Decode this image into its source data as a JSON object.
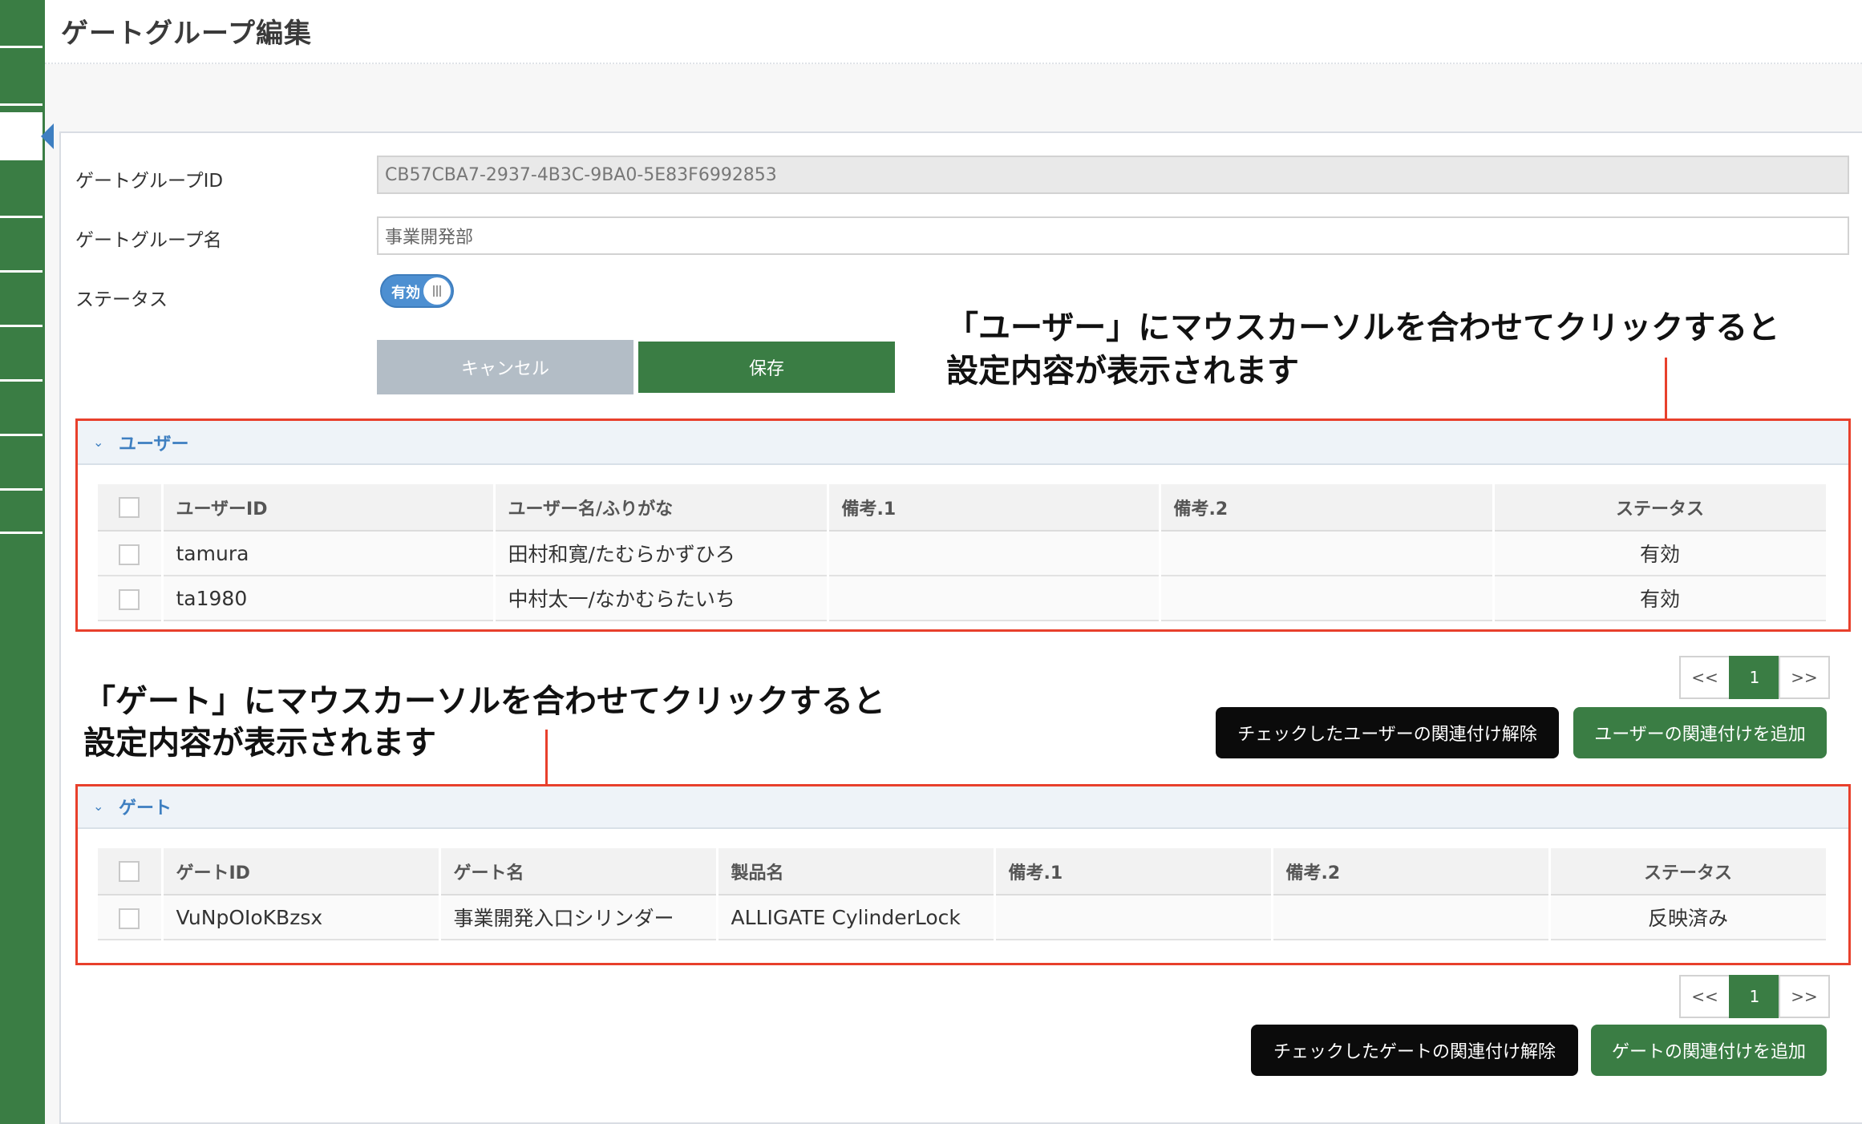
{
  "page": {
    "title": "ゲートグループ編集"
  },
  "form": {
    "gate_group_id_label": "ゲートグループID",
    "gate_group_id_value": "CB57CBA7-2937-4B3C-9BA0-5E83F6992853",
    "gate_group_name_label": "ゲートグループ名",
    "gate_group_name_value": "事業開発部",
    "status_label": "ステータス",
    "status_toggle_label": "有効",
    "cancel_label": "キャンセル",
    "save_label": "保存"
  },
  "annotations": {
    "user_line1": "「ユーザー」にマウスカーソルを合わせてクリックすると",
    "user_line2": "設定内容が表示されます",
    "gate_line1": "「ゲート」にマウスカーソルを合わせてクリックすると",
    "gate_line2": "設定内容が表示されます"
  },
  "users": {
    "section_title": "ユーザー",
    "columns": {
      "id": "ユーザーID",
      "name": "ユーザー名/ふりがな",
      "note1": "備考.1",
      "note2": "備考.2",
      "status": "ステータス"
    },
    "rows": [
      {
        "id": "tamura",
        "name": "田村和寛/たむらかずひろ",
        "note1": "",
        "note2": "",
        "status": "有効"
      },
      {
        "id": "ta1980",
        "name": "中村太一/なかむらたいち",
        "note1": "",
        "note2": "",
        "status": "有効"
      }
    ],
    "pager": {
      "prev": "<<",
      "page": "1",
      "next": ">>"
    },
    "unlink_label": "チェックしたユーザーの関連付け解除",
    "add_label": "ユーザーの関連付けを追加"
  },
  "gates": {
    "section_title": "ゲート",
    "columns": {
      "id": "ゲートID",
      "name": "ゲート名",
      "product": "製品名",
      "note1": "備考.1",
      "note2": "備考.2",
      "status": "ステータス"
    },
    "rows": [
      {
        "id": "VuNpOIoKBzsx",
        "name": "事業開発入口シリンダー",
        "product": "ALLIGATE CylinderLock",
        "note1": "",
        "note2": "",
        "status": "反映済み"
      }
    ],
    "pager": {
      "prev": "<<",
      "page": "1",
      "next": ">>"
    },
    "unlink_label": "チェックしたゲートの関連付け解除",
    "add_label": "ゲートの関連付けを追加"
  },
  "colors": {
    "sidebar": "#3a7d44",
    "accent_blue": "#3e7fc1",
    "annotation_red": "#e8402c"
  }
}
